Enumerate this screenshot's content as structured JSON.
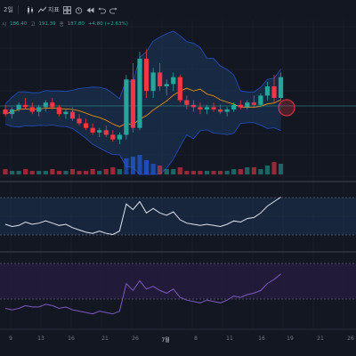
{
  "toolbar": {
    "interval": "2일",
    "indicators_label": "지표"
  },
  "legend": {
    "o_key": "시",
    "o_val": "186.40",
    "h_key": "고",
    "h_val": "191.39",
    "c_key": "종",
    "c_val": "187.80",
    "chg": "+4.80 (+2.63%)"
  },
  "x_axis_labels": [
    {
      "text": "9",
      "bold": false
    },
    {
      "text": "13",
      "bold": false
    },
    {
      "text": "16",
      "bold": false
    },
    {
      "text": "18",
      "bold": false
    },
    {
      "text": "21",
      "bold": false
    },
    {
      "text": "26",
      "bold": false
    },
    {
      "text": "7월",
      "bold": true
    },
    {
      "text": "8",
      "bold": false
    },
    {
      "text": "11",
      "bold": false
    },
    {
      "text": "16",
      "bold": false
    },
    {
      "text": "19",
      "bold": false
    },
    {
      "text": "21",
      "bold": false
    },
    {
      "text": "26",
      "bold": false
    }
  ],
  "chart_data": {
    "type": "candlestick",
    "candles": [
      {
        "o": 140,
        "h": 142,
        "l": 137,
        "c": 138
      },
      {
        "o": 138,
        "h": 141,
        "l": 136,
        "c": 140
      },
      {
        "o": 140,
        "h": 143,
        "l": 139,
        "c": 142
      },
      {
        "o": 142,
        "h": 145,
        "l": 140,
        "c": 141
      },
      {
        "o": 141,
        "h": 143,
        "l": 138,
        "c": 139
      },
      {
        "o": 139,
        "h": 142,
        "l": 137,
        "c": 141
      },
      {
        "o": 141,
        "h": 144,
        "l": 139,
        "c": 143
      },
      {
        "o": 143,
        "h": 145,
        "l": 140,
        "c": 141
      },
      {
        "o": 141,
        "h": 142,
        "l": 137,
        "c": 138
      },
      {
        "o": 138,
        "h": 140,
        "l": 136,
        "c": 139
      },
      {
        "o": 139,
        "h": 141,
        "l": 135,
        "c": 136
      },
      {
        "o": 136,
        "h": 138,
        "l": 133,
        "c": 134
      },
      {
        "o": 134,
        "h": 136,
        "l": 131,
        "c": 132
      },
      {
        "o": 132,
        "h": 134,
        "l": 129,
        "c": 130
      },
      {
        "o": 130,
        "h": 132,
        "l": 128,
        "c": 131
      },
      {
        "o": 131,
        "h": 133,
        "l": 128,
        "c": 129
      },
      {
        "o": 129,
        "h": 131,
        "l": 126,
        "c": 127
      },
      {
        "o": 127,
        "h": 130,
        "l": 125,
        "c": 129
      },
      {
        "o": 129,
        "h": 155,
        "l": 127,
        "c": 153
      },
      {
        "o": 153,
        "h": 160,
        "l": 130,
        "c": 132
      },
      {
        "o": 132,
        "h": 165,
        "l": 131,
        "c": 162
      },
      {
        "o": 162,
        "h": 166,
        "l": 145,
        "c": 148
      },
      {
        "o": 148,
        "h": 158,
        "l": 145,
        "c": 156
      },
      {
        "o": 156,
        "h": 160,
        "l": 148,
        "c": 150
      },
      {
        "o": 150,
        "h": 153,
        "l": 146,
        "c": 151
      },
      {
        "o": 151,
        "h": 156,
        "l": 148,
        "c": 154
      },
      {
        "o": 154,
        "h": 155,
        "l": 143,
        "c": 144
      },
      {
        "o": 144,
        "h": 146,
        "l": 140,
        "c": 142
      },
      {
        "o": 142,
        "h": 144,
        "l": 139,
        "c": 141
      },
      {
        "o": 141,
        "h": 143,
        "l": 138,
        "c": 140
      },
      {
        "o": 140,
        "h": 142,
        "l": 138,
        "c": 141
      },
      {
        "o": 141,
        "h": 143,
        "l": 139,
        "c": 140
      },
      {
        "o": 140,
        "h": 142,
        "l": 138,
        "c": 139
      },
      {
        "o": 139,
        "h": 141,
        "l": 137,
        "c": 140
      },
      {
        "o": 140,
        "h": 143,
        "l": 139,
        "c": 142
      },
      {
        "o": 142,
        "h": 144,
        "l": 140,
        "c": 141
      },
      {
        "o": 141,
        "h": 144,
        "l": 140,
        "c": 143
      },
      {
        "o": 143,
        "h": 146,
        "l": 141,
        "c": 142
      },
      {
        "o": 142,
        "h": 147,
        "l": 141,
        "c": 146
      },
      {
        "o": 146,
        "h": 152,
        "l": 144,
        "c": 150
      },
      {
        "o": 150,
        "h": 155,
        "l": 143,
        "c": 145
      },
      {
        "o": 145,
        "h": 156,
        "l": 144,
        "c": 154
      }
    ],
    "volume": [
      3,
      2,
      2,
      3,
      2,
      2,
      2,
      3,
      2,
      2,
      3,
      2,
      2,
      3,
      2,
      3,
      4,
      3,
      9,
      10,
      11,
      8,
      6,
      5,
      3,
      3,
      4,
      2,
      2,
      2,
      2,
      2,
      2,
      2,
      3,
      3,
      4,
      4,
      3,
      5,
      7,
      6
    ],
    "rsi": [
      42,
      40,
      41,
      44,
      42,
      43,
      45,
      43,
      41,
      42,
      39,
      37,
      35,
      34,
      36,
      34,
      33,
      36,
      60,
      55,
      62,
      52,
      56,
      52,
      50,
      53,
      46,
      43,
      42,
      41,
      42,
      41,
      40,
      42,
      45,
      44,
      47,
      48,
      52,
      58,
      62,
      66
    ],
    "panel3": [
      20,
      19,
      20,
      22,
      21,
      21,
      23,
      22,
      20,
      21,
      19,
      18,
      17,
      16,
      18,
      17,
      16,
      18,
      38,
      33,
      40,
      34,
      36,
      33,
      31,
      34,
      28,
      26,
      25,
      24,
      26,
      25,
      24,
      26,
      29,
      28,
      30,
      31,
      33,
      38,
      41,
      45
    ]
  }
}
